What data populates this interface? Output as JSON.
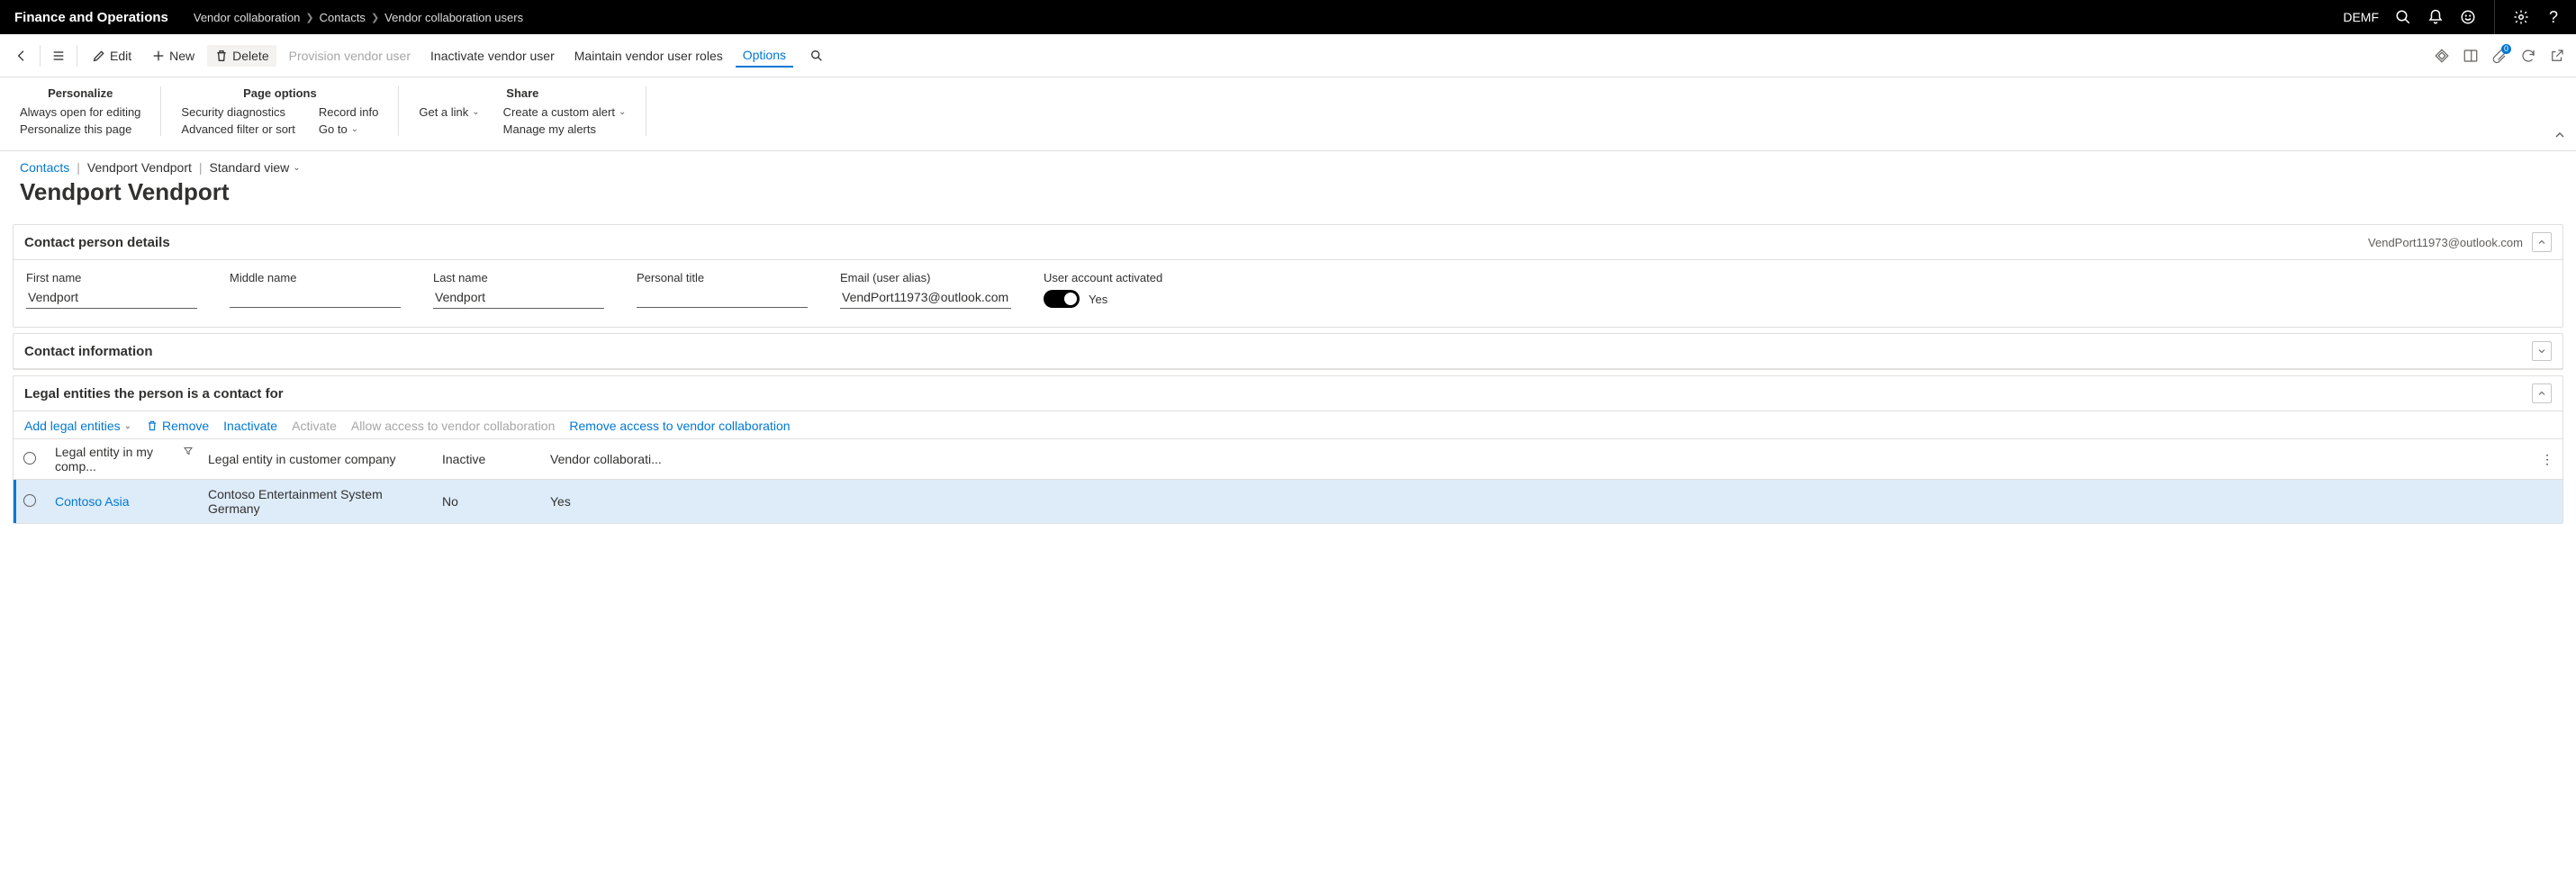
{
  "app_title": "Finance and Operations",
  "company": "DEMF",
  "top_breadcrumb": [
    "Vendor collaboration",
    "Contacts",
    "Vendor collaboration users"
  ],
  "actionbar": {
    "edit": "Edit",
    "new": "New",
    "delete": "Delete",
    "provision": "Provision vendor user",
    "inactivate": "Inactivate vendor user",
    "maintain": "Maintain vendor user roles",
    "options": "Options"
  },
  "ribbon": {
    "personalize": {
      "title": "Personalize",
      "always_open": "Always open for editing",
      "personalize_page": "Personalize this page"
    },
    "page_options": {
      "title": "Page options",
      "security": "Security diagnostics",
      "advfilter": "Advanced filter or sort",
      "record_info": "Record info",
      "goto": "Go to"
    },
    "share": {
      "title": "Share",
      "get_link": "Get a link",
      "custom_alert": "Create a custom alert",
      "manage_alerts": "Manage my alerts"
    }
  },
  "page_crumb": {
    "link": "Contacts",
    "entity": "Vendport Vendport",
    "view": "Standard view"
  },
  "page_title": "Vendport Vendport",
  "contact_details": {
    "header": "Contact person details",
    "summary_email": "VendPort11973@outlook.com",
    "fields": {
      "first_name_label": "First name",
      "first_name": "Vendport",
      "middle_name_label": "Middle name",
      "middle_name": "",
      "last_name_label": "Last name",
      "last_name": "Vendport",
      "personal_title_label": "Personal title",
      "personal_title": "",
      "email_label": "Email (user alias)",
      "email": "VendPort11973@outlook.com",
      "activated_label": "User account activated",
      "activated_value": "Yes"
    }
  },
  "contact_info": {
    "header": "Contact information"
  },
  "legal_entities": {
    "header": "Legal entities the person is a contact for",
    "toolbar": {
      "add": "Add legal entities",
      "remove": "Remove",
      "inactivate": "Inactivate",
      "activate": "Activate",
      "allow": "Allow access to vendor collaboration",
      "remove_access": "Remove access to vendor collaboration"
    },
    "columns": {
      "mine": "Legal entity in my comp...",
      "customer": "Legal entity in customer company",
      "inactive": "Inactive",
      "collab": "Vendor collaborati..."
    },
    "rows": [
      {
        "mine": "Contoso Asia",
        "customer": "Contoso Entertainment System Germany",
        "inactive": "No",
        "collab": "Yes",
        "selected": true
      }
    ]
  },
  "attach_badge": "0"
}
